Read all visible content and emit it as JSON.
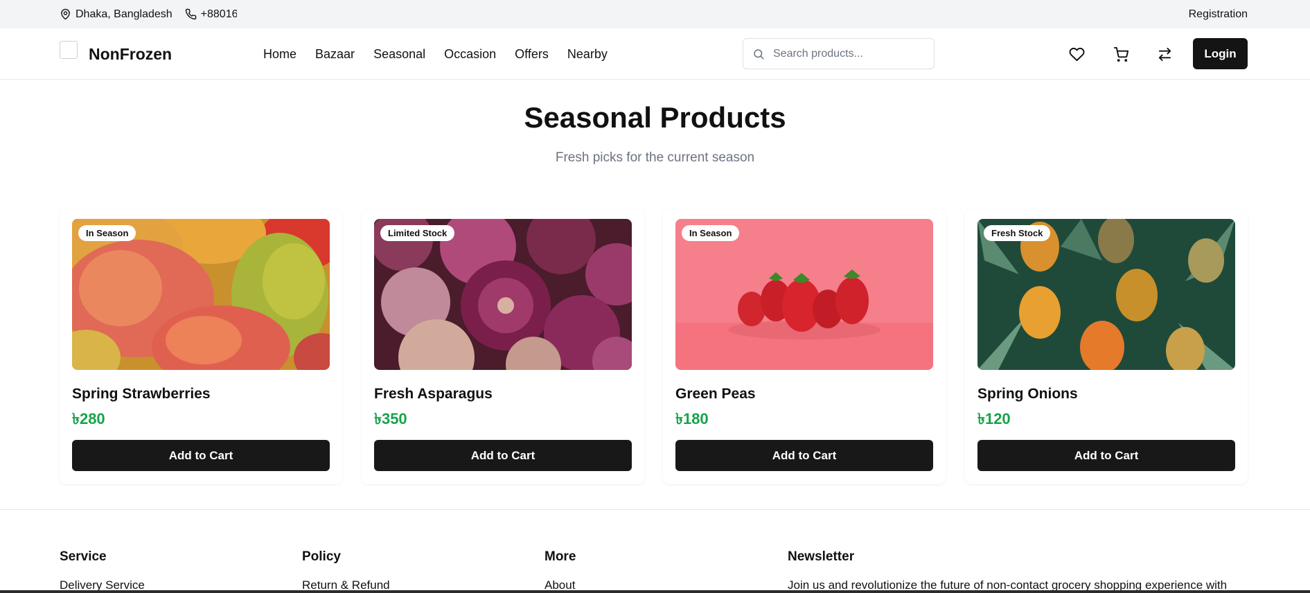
{
  "topbar": {
    "location": "Dhaka, Bangladesh",
    "phone": "+88016",
    "registration": "Registration"
  },
  "header": {
    "brand": "NonFrozen",
    "nav": [
      "Home",
      "Bazaar",
      "Seasonal",
      "Occasion",
      "Offers",
      "Nearby"
    ],
    "search_placeholder": "Search products...",
    "login": "Login"
  },
  "main": {
    "title": "Seasonal Products",
    "subtitle": "Fresh picks for the current season",
    "products": [
      {
        "badge": "In Season",
        "name": "Spring Strawberries",
        "price": "৳280",
        "button": "Add to Cart"
      },
      {
        "badge": "Limited Stock",
        "name": "Fresh Asparagus",
        "price": "৳350",
        "button": "Add to Cart"
      },
      {
        "badge": "In Season",
        "name": "Green Peas",
        "price": "৳180",
        "button": "Add to Cart"
      },
      {
        "badge": "Fresh Stock",
        "name": "Spring Onions",
        "price": "৳120",
        "button": "Add to Cart"
      }
    ]
  },
  "footer": {
    "service": {
      "heading": "Service",
      "first_link": "Delivery Service"
    },
    "policy": {
      "heading": "Policy",
      "first_link": "Return & Refund"
    },
    "more": {
      "heading": "More",
      "first_link": "About"
    },
    "newsletter": {
      "heading": "Newsletter",
      "text": "Join us and revolutionize the future of non-contact grocery shopping experience with"
    }
  },
  "colors": {
    "accent_price": "#16a34a",
    "button_dark": "#181818",
    "topbar_bg": "#f3f4f6"
  }
}
